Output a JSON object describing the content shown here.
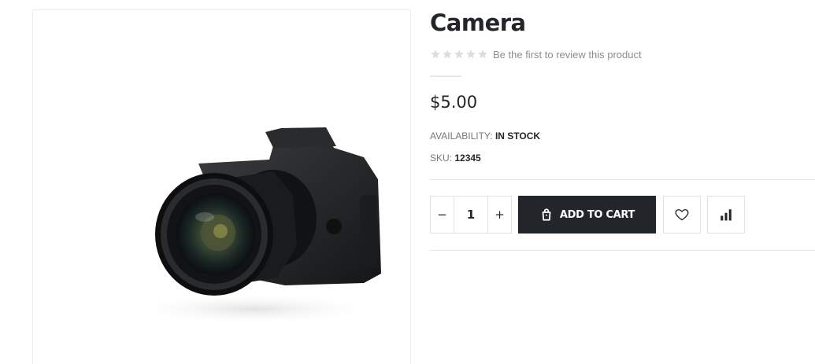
{
  "product": {
    "title": "Camera",
    "rating_stars": 0,
    "review_link": "Be the first to review this product",
    "price": "$5.00",
    "availability_label": "AVAILABILITY:",
    "availability_value": "IN STOCK",
    "sku_label": "SKU:",
    "sku_value": "12345"
  },
  "cart": {
    "quantity": "1",
    "minus": "−",
    "plus": "+",
    "add_label": "ADD TO CART"
  },
  "icons": {
    "rating": "star-icon",
    "cart": "shopping-bag-icon",
    "wishlist": "heart-icon",
    "compare": "bar-chart-icon"
  },
  "colors": {
    "primary_button": "#222529",
    "star_empty": "#dddddd",
    "border": "#e1e1e1"
  }
}
